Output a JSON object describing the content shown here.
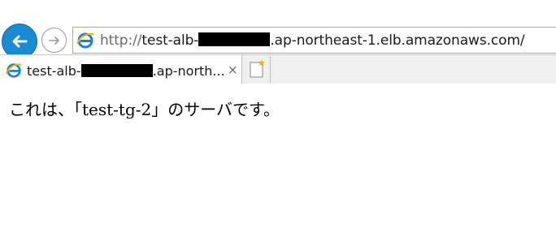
{
  "browser": {
    "address": {
      "protocol": "http://",
      "host_prefix": "test-alb-",
      "host_suffix": ".ap-northeast-1.elb.amazonaws.com/"
    },
    "tab": {
      "title_prefix": "test-alb-",
      "title_suffix": ".ap-north...",
      "close_glyph": "×"
    },
    "icons": {
      "back": "back-arrow-icon",
      "forward": "forward-arrow-icon",
      "site": "ie-logo-icon",
      "new_tab": "new-tab-icon"
    },
    "colors": {
      "accent": "#1a8ad4",
      "ie_blue": "#1f7fd4",
      "ie_gold": "#f2b200"
    }
  },
  "page": {
    "text": "これは、「test-tg-2」のサーバです。"
  }
}
